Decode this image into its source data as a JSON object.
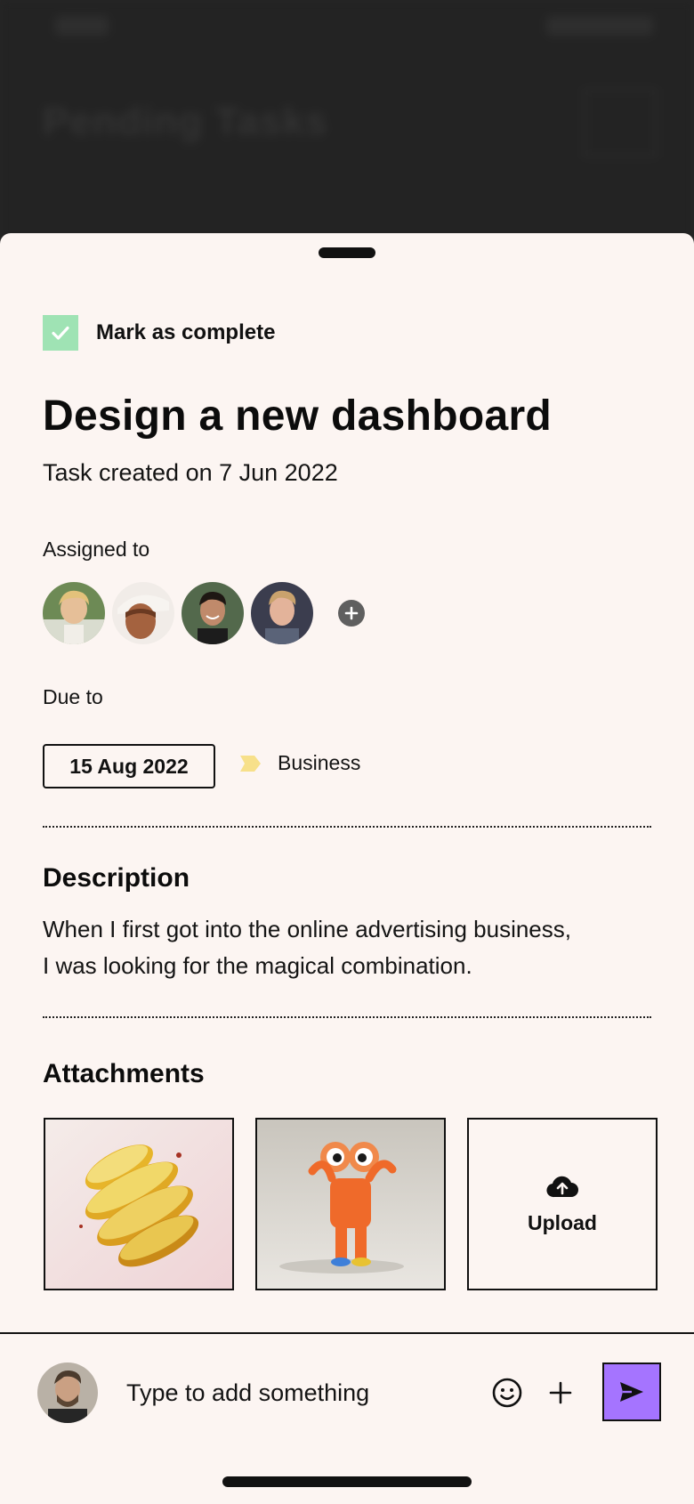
{
  "background": {
    "page_title": "Pending Tasks"
  },
  "task": {
    "mark_complete_label": "Mark as complete",
    "completed": true,
    "title": "Design a new dashboard",
    "created": "Task created on 7 Jun 2022"
  },
  "assigned": {
    "label": "Assigned to",
    "avatars": [
      "avatar-woman-blonde",
      "avatar-woman-hat",
      "avatar-man-dark-hair",
      "avatar-man-blond"
    ],
    "add_icon": "plus-circle-icon"
  },
  "due": {
    "label": "Due to",
    "date": "15 Aug 2022",
    "tag_icon": "tag-icon",
    "tag_color": "#f7e08a",
    "tag_label": "Business"
  },
  "description": {
    "title": "Description",
    "line1": "When I first got into the online advertising business,",
    "line2": "I was looking for the magical combination."
  },
  "attachments": {
    "title": "Attachments",
    "items": [
      "sliced-lemon-image",
      "cartoon-character-image"
    ],
    "upload_icon": "cloud-upload-icon",
    "upload_label": "Upload"
  },
  "composer": {
    "placeholder": "Type to add something",
    "send_color": "#a574ff",
    "checkbox_color": "#9fe3b4"
  }
}
